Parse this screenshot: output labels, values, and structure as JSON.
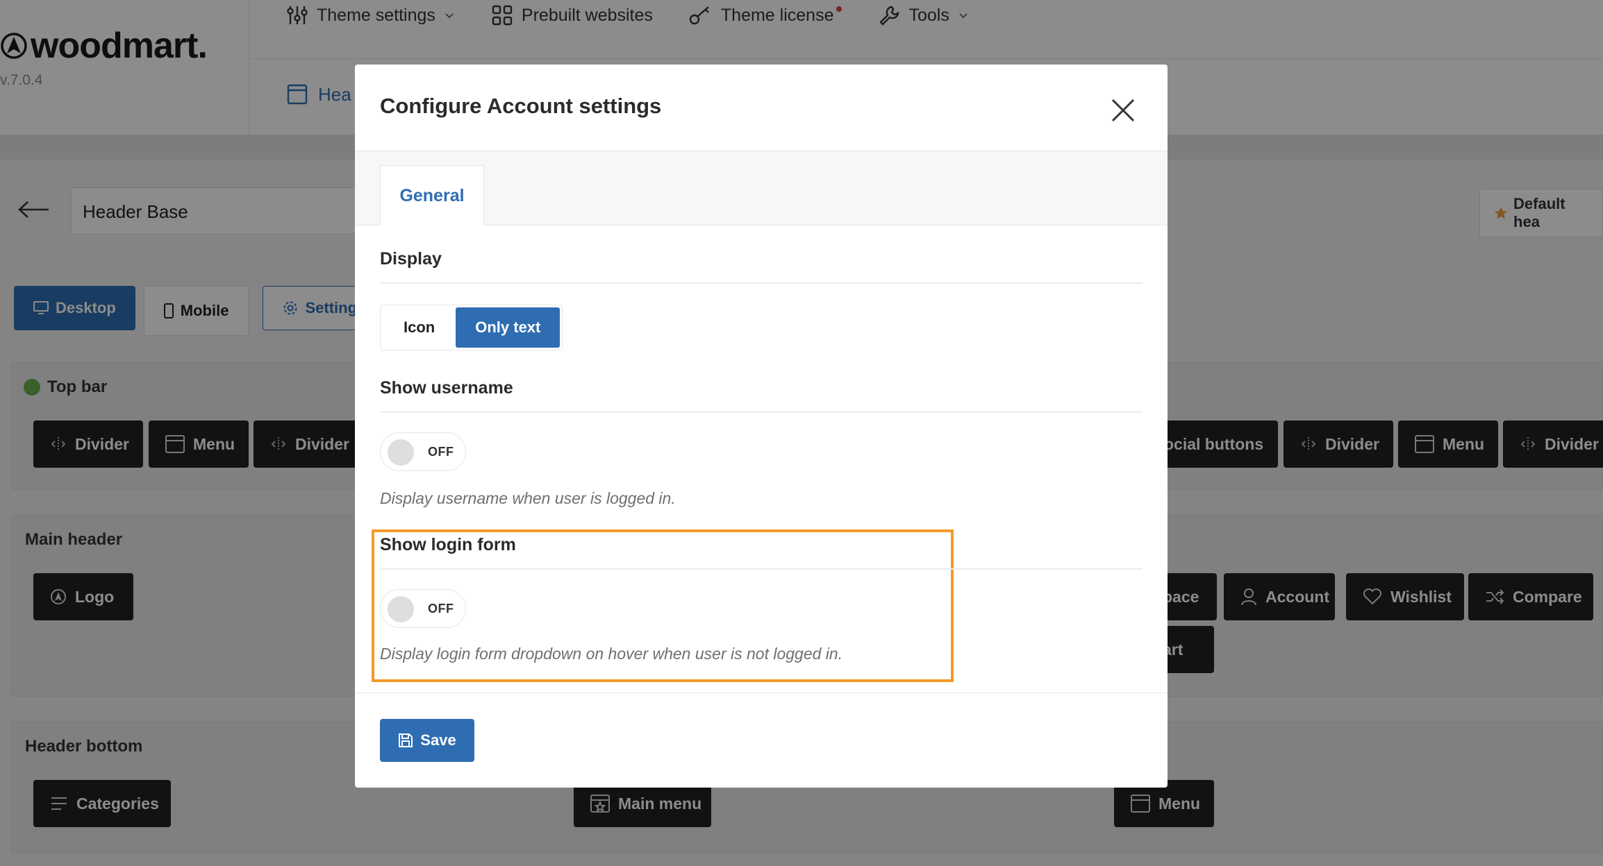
{
  "brand": {
    "name": "woodmart.",
    "version": "v.7.0.4"
  },
  "topnav": {
    "items": [
      {
        "label": "Theme settings",
        "icon": "sliders-icon"
      },
      {
        "label": "Prebuilt websites",
        "icon": "grid-icon"
      },
      {
        "label": "Theme license",
        "icon": "key-icon"
      },
      {
        "label": "Tools",
        "icon": "wrench-icon"
      }
    ],
    "subnav_label": "Hea"
  },
  "builder": {
    "header_name": "Header Base",
    "default_header_label": "Default hea",
    "devices": {
      "desktop": "Desktop",
      "mobile": "Mobile",
      "settings": "Setting"
    }
  },
  "rows": {
    "top_bar": {
      "title": "Top bar",
      "left_items": [
        "Divider",
        "Menu",
        "Divider"
      ],
      "right_items": [
        "ocial buttons",
        "Divider",
        "Menu",
        "Divider"
      ]
    },
    "main_header": {
      "title": "Main header",
      "left_items": [
        "Logo"
      ],
      "right_items": [
        "pace",
        "Account",
        "Wishlist",
        "Compare"
      ],
      "right_items_row2": [
        "art"
      ]
    },
    "header_bottom": {
      "title": "Header bottom",
      "left_items": [
        "Categories"
      ],
      "middle_items": [
        "Main menu"
      ],
      "right_items": [
        "Menu"
      ]
    }
  },
  "modal": {
    "title": "Configure Account settings",
    "tab": "General",
    "display": {
      "title": "Display",
      "options": [
        "Icon",
        "Only text"
      ],
      "selected": "Only text"
    },
    "show_username": {
      "title": "Show username",
      "state": "OFF",
      "description": "Display username when user is logged in."
    },
    "show_login_form": {
      "title": "Show login form",
      "state": "OFF",
      "description": "Display login form dropdown on hover when user is not logged in."
    },
    "save_label": "Save"
  },
  "colors": {
    "accent": "#2f6db2",
    "highlight": "#f39a2b",
    "chip": "#222222",
    "status_green": "#6ab04c"
  }
}
